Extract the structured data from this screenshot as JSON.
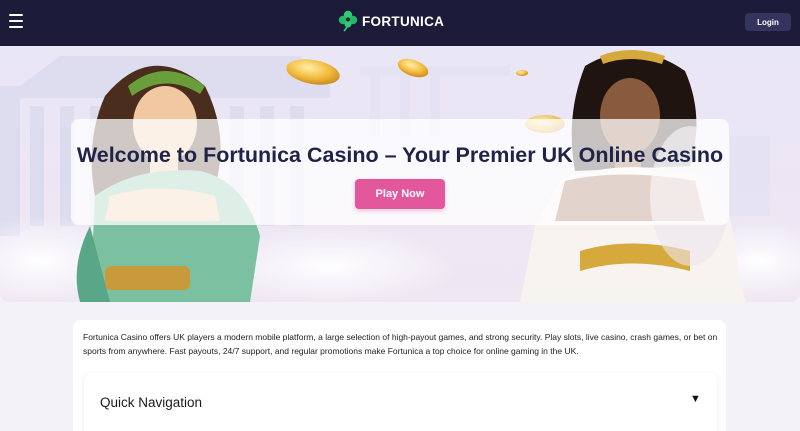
{
  "header": {
    "brand": "FORTUNICA",
    "login_label": "Login"
  },
  "hero": {
    "title": "Welcome to Fortunica Casino – Your Premier UK Online Casino",
    "cta_label": "Play Now"
  },
  "intro": {
    "text": "Fortunica Casino offers UK players a modern mobile platform, a large selection of high-payout games, and strong security. Play slots, live casino, crash games, or bet on sports from anywhere. Fast payouts, 24/7 support, and regular promotions make Fortunica a top choice for online gaming in the UK."
  },
  "quick_nav": {
    "label": "Quick Navigation",
    "arrow": "▼"
  },
  "icons": {
    "menu": "hamburger-menu-icon",
    "logo": "clover-icon"
  },
  "colors": {
    "header_bg": "#1c1c3a",
    "login_bg": "#34345e",
    "brand_green": "#2ecc71",
    "cta_pink": "#e3589c",
    "title_navy": "#1f2347"
  }
}
